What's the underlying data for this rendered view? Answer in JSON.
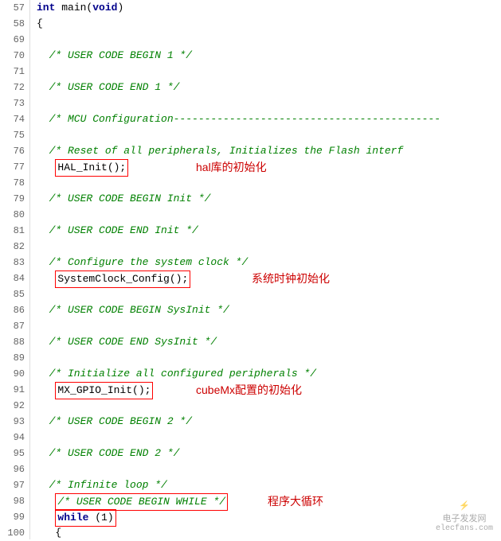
{
  "lines": [
    {
      "num": "57",
      "content": "int_main",
      "type": "funcdef"
    },
    {
      "num": "58",
      "content": "{",
      "type": "brace"
    },
    {
      "num": "69",
      "content": "",
      "type": "empty"
    },
    {
      "num": "70",
      "content": "/* USER CODE BEGIN 1 */",
      "type": "comment"
    },
    {
      "num": "71",
      "content": "",
      "type": "empty"
    },
    {
      "num": "72",
      "content": "/* USER CODE END 1 */",
      "type": "comment"
    },
    {
      "num": "73",
      "content": "",
      "type": "empty"
    },
    {
      "num": "74",
      "content": "/* MCU Configuration----------------------------------",
      "type": "comment"
    },
    {
      "num": "75",
      "content": "",
      "type": "empty"
    },
    {
      "num": "76",
      "content": "/* Reset of all peripherals, Initializes the Flash interf",
      "type": "comment"
    },
    {
      "num": "77",
      "content": "HAL_Init();",
      "type": "boxed"
    },
    {
      "num": "78",
      "content": "",
      "type": "empty"
    },
    {
      "num": "79",
      "content": "/* USER CODE BEGIN Init */",
      "type": "comment"
    },
    {
      "num": "80",
      "content": "",
      "type": "empty"
    },
    {
      "num": "81",
      "content": "/* USER CODE END Init */",
      "type": "comment"
    },
    {
      "num": "82",
      "content": "",
      "type": "empty"
    },
    {
      "num": "83",
      "content": "/* Configure the system clock */",
      "type": "comment"
    },
    {
      "num": "84",
      "content": "SystemClock_Config();",
      "type": "boxed2"
    },
    {
      "num": "85",
      "content": "",
      "type": "empty"
    },
    {
      "num": "86",
      "content": "/* USER CODE BEGIN SysInit */",
      "type": "comment"
    },
    {
      "num": "87",
      "content": "",
      "type": "empty"
    },
    {
      "num": "88",
      "content": "/* USER CODE END SysInit */",
      "type": "comment"
    },
    {
      "num": "89",
      "content": "",
      "type": "empty"
    },
    {
      "num": "90",
      "content": "/* Initialize all configured peripherals */",
      "type": "comment"
    },
    {
      "num": "91",
      "content": "MX_GPIO_Init();",
      "type": "boxed3"
    },
    {
      "num": "92",
      "content": "",
      "type": "empty"
    },
    {
      "num": "93",
      "content": "/* USER CODE BEGIN 2 */",
      "type": "comment"
    },
    {
      "num": "94",
      "content": "",
      "type": "empty"
    },
    {
      "num": "95",
      "content": "/* USER CODE END 2 */",
      "type": "comment"
    },
    {
      "num": "96",
      "content": "",
      "type": "empty"
    },
    {
      "num": "97",
      "content": "/* Infinite loop */",
      "type": "comment"
    },
    {
      "num": "98",
      "content": "/* USER CODE BEGIN WHILE */",
      "type": "commentboxed"
    },
    {
      "num": "99",
      "content": "while (1)",
      "type": "while"
    },
    {
      "num": "100",
      "content": "{",
      "type": "brace2"
    }
  ],
  "annotations": {
    "hal_init": "hal库的初始化",
    "sysclock": "系统时钟初始化",
    "cubemx": "cubeMx配置的初始化",
    "loop": "程序大循环"
  },
  "watermark": {
    "line1": "电子发发网",
    "line2": "elecfans.com"
  }
}
